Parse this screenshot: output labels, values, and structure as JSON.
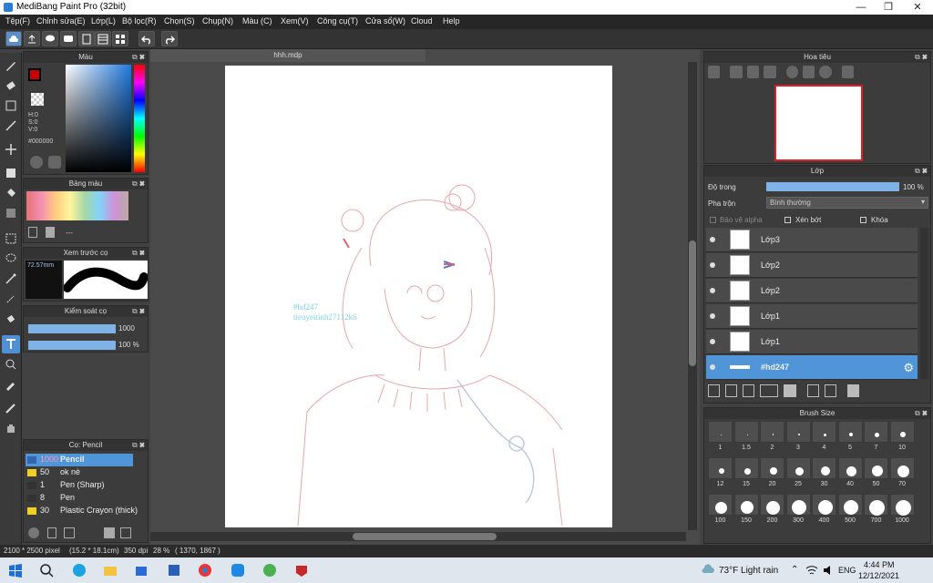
{
  "window": {
    "title": "MediBang Paint Pro (32bit)"
  },
  "menu": [
    "Tệp(F)",
    "Chỉnh sửa(E)",
    "Lớp(L)",
    "Bộ lọc(R)",
    "Chọn(S)",
    "Chụp(N)",
    "Màu (C)",
    "Xem(V)",
    "Công cụ(T)",
    "Cửa sổ(W)",
    "Cloud",
    "Help"
  ],
  "color_panel": {
    "title": "Màu",
    "h": "H:0",
    "s": "S:0",
    "v": "V:0",
    "hex": "#000000",
    "primary_color": "#cc0000"
  },
  "palette_panel": {
    "title": "Bảng màu",
    "selected": "---"
  },
  "brush_preview_panel": {
    "title": "Xem trước cọ",
    "size": "72.57mm"
  },
  "brush_control_panel": {
    "title": "Kiểm soát cọ",
    "size_value": "1000",
    "opacity_value": "100 %"
  },
  "brush_list_panel": {
    "title": "Cọ: Pencil",
    "items": [
      {
        "size": "1000",
        "name": "Pencil",
        "color": "#3366aa",
        "selected": true
      },
      {
        "size": "50",
        "name": "ok nè",
        "color": "#f0d020"
      },
      {
        "size": "1",
        "name": "Pen (Sharp)",
        "color": "#333333"
      },
      {
        "size": "8",
        "name": "Pen",
        "color": "#333333"
      },
      {
        "size": "30",
        "name": "Plastic Crayon (thick)",
        "color": "#f0d020"
      }
    ]
  },
  "document": {
    "tab": "hhh.mdp",
    "watermark_line1": "#hd247",
    "watermark_line2": "tieuyeitinh27112k6"
  },
  "navigator_panel": {
    "title": "Hoa tiêu"
  },
  "layer_panel": {
    "title": "Lớp",
    "opacity_label": "Độ trong",
    "opacity_value": "100 %",
    "blend_label": "Pha trộn",
    "blend_value": "Bình thường",
    "protect_alpha": "Bảo vệ alpha",
    "clipping": "Xén bớt",
    "lock": "Khóa",
    "layers": [
      {
        "name": "Lớp3",
        "selected": false
      },
      {
        "name": "Lớp2",
        "selected": false
      },
      {
        "name": "Lớp2",
        "selected": false
      },
      {
        "name": "Lớp1",
        "selected": false
      },
      {
        "name": "Lớp1",
        "selected": false
      },
      {
        "name": "#hd247",
        "selected": true
      }
    ]
  },
  "brush_size_panel": {
    "title": "Brush Size",
    "rows": [
      [
        "1",
        "1.5",
        "2",
        "3",
        "4",
        "5",
        "7",
        "10"
      ],
      [
        "12",
        "15",
        "20",
        "25",
        "30",
        "40",
        "50",
        "70"
      ],
      [
        "100",
        "150",
        "200",
        "300",
        "400",
        "500",
        "700",
        "1000"
      ]
    ]
  },
  "status": {
    "size": "2100 * 2500 pixel",
    "physical": "(15.2 * 18.1cm)",
    "dpi": "350 dpi",
    "zoom": "28 %",
    "coords": "( 1370, 1867 )"
  },
  "taskbar": {
    "weather": "73°F Light rain",
    "lang": "ENG",
    "time": "4:44 PM",
    "date": "12/12/2021"
  }
}
